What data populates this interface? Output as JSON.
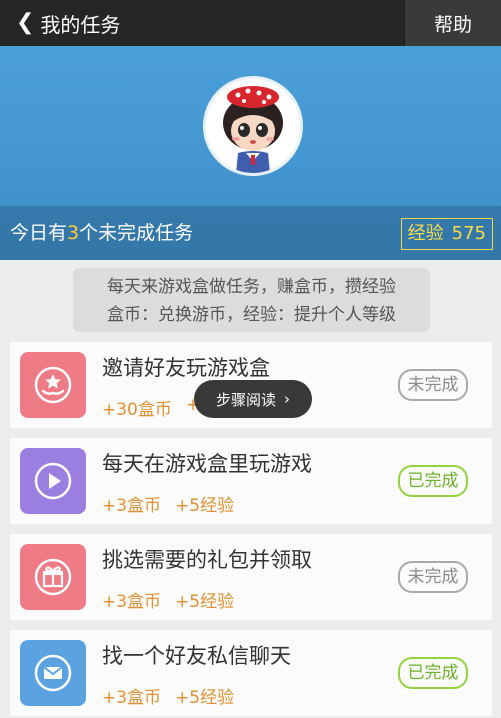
{
  "header": {
    "back_icon": "chevron-left-icon",
    "title": "我的任务",
    "help_label": "帮助"
  },
  "summary": {
    "prefix": "今日有",
    "count": "3",
    "suffix": "个未完成任务",
    "exp_label": "经验",
    "exp_value": "575"
  },
  "notice": {
    "line1": "每天来游戏盒做任务，赚盒币，攒经验",
    "line2": "盒币：兑换游币，经验：提升个人等级"
  },
  "tasks": [
    {
      "name": "邀请好友玩游戏盒",
      "coins": "+30盒币",
      "exp": "+",
      "status": "未完成",
      "icon": "star-hand-icon",
      "color": "#ef7b86"
    },
    {
      "name": "每天在游戏盒里玩游戏",
      "coins": "+3盒币",
      "exp": "+5经验",
      "status": "已完成",
      "icon": "play-icon",
      "color": "#9b7fe0"
    },
    {
      "name": "挑选需要的礼包并领取",
      "coins": "+3盒币",
      "exp": "+5经验",
      "status": "未完成",
      "icon": "gift-icon",
      "color": "#ef7b86"
    },
    {
      "name": "找一个好友私信聊天",
      "coins": "+3盒币",
      "exp": "+5经验",
      "status": "已完成",
      "icon": "mail-icon",
      "color": "#5aa3e0"
    }
  ],
  "tooltip": {
    "label": "步骤阅读",
    "icon": "chevron-right-icon"
  },
  "colors": {
    "topbar": "#262626",
    "profile_bg": "#4b9fd8",
    "highlight": "#ffcb3a",
    "reward": "#e0902e",
    "done": "#93d33c"
  }
}
